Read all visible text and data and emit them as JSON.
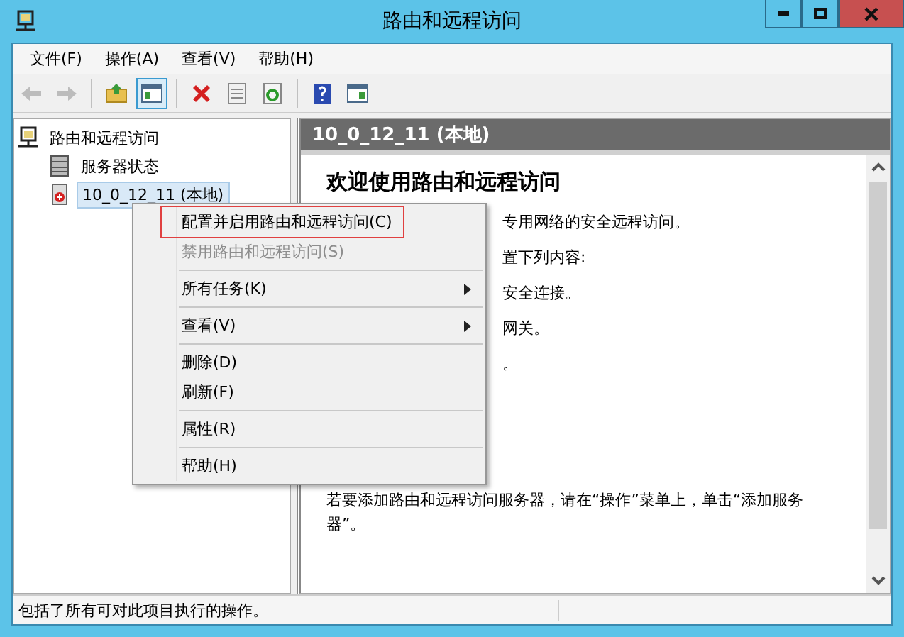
{
  "window": {
    "title": "路由和远程访问"
  },
  "menu_bar": [
    "文件(F)",
    "操作(A)",
    "查看(V)",
    "帮助(H)"
  ],
  "toolbar": [
    {
      "kind": "back",
      "disabled": true,
      "pressed": false
    },
    {
      "kind": "forward",
      "disabled": true,
      "pressed": false
    },
    {
      "kind": "separator"
    },
    {
      "kind": "up",
      "disabled": false,
      "pressed": false
    },
    {
      "kind": "tree",
      "disabled": false,
      "pressed": true
    },
    {
      "kind": "separator"
    },
    {
      "kind": "delete",
      "disabled": false,
      "pressed": false
    },
    {
      "kind": "properties",
      "disabled": false,
      "pressed": false
    },
    {
      "kind": "refresh",
      "disabled": false,
      "pressed": false
    },
    {
      "kind": "separator"
    },
    {
      "kind": "help",
      "disabled": false,
      "pressed": false
    },
    {
      "kind": "actionpane",
      "disabled": false,
      "pressed": false
    }
  ],
  "tree": {
    "label": "路由和远程访问",
    "children": [
      {
        "label": "服务器状态",
        "kind": "status",
        "selected": false
      },
      {
        "label": "10_0_12_11 (本地)",
        "kind": "server",
        "selected": true
      }
    ]
  },
  "pane": {
    "header": "10_0_12_11 (本地)",
    "heading": "欢迎使用路由和远程访问",
    "lines": [
      "专用网络的安全远程访问。",
      "置下列内容:",
      "安全连接。",
      "网关。",
      "。"
    ],
    "footer": "若要添加路由和远程访问服务器，请在“操作”菜单上，单击“添加服务器”。"
  },
  "context_menu": {
    "items": [
      {
        "kind": "item",
        "label": "配置并启用路由和远程访问(C)",
        "disabled": false,
        "submenu": false,
        "highlighted": true
      },
      {
        "kind": "item",
        "label": "禁用路由和远程访问(S)",
        "disabled": true,
        "submenu": false,
        "highlighted": false
      },
      {
        "kind": "separator"
      },
      {
        "kind": "item",
        "label": "所有任务(K)",
        "disabled": false,
        "submenu": true,
        "highlighted": false
      },
      {
        "kind": "separator"
      },
      {
        "kind": "item",
        "label": "查看(V)",
        "disabled": false,
        "submenu": true,
        "highlighted": false
      },
      {
        "kind": "separator"
      },
      {
        "kind": "item",
        "label": "删除(D)",
        "disabled": false,
        "submenu": false,
        "highlighted": false
      },
      {
        "kind": "item",
        "label": "刷新(F)",
        "disabled": false,
        "submenu": false,
        "highlighted": false
      },
      {
        "kind": "separator"
      },
      {
        "kind": "item",
        "label": "属性(R)",
        "disabled": false,
        "submenu": false,
        "highlighted": false
      },
      {
        "kind": "separator"
      },
      {
        "kind": "item",
        "label": "帮助(H)",
        "disabled": false,
        "submenu": false,
        "highlighted": false
      }
    ]
  },
  "status_bar": "包括了所有可对此项目执行的操作。"
}
